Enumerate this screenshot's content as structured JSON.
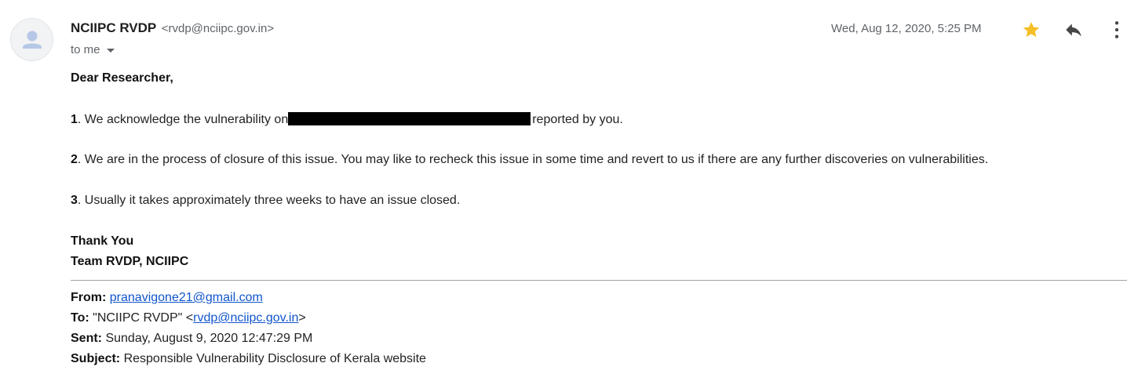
{
  "header": {
    "sender_name": "NCIIPC RVDP",
    "sender_email": "<rvdp@nciipc.gov.in>",
    "recipient_label": "to me",
    "date": "Wed, Aug 12, 2020, 5:25 PM",
    "starred": true,
    "icons": {
      "avatar": "default-person-icon",
      "star": "star-icon",
      "reply": "reply-icon",
      "more": "more-vert-icon",
      "caret": "caret-down-icon"
    },
    "colors": {
      "star": "#f6bf26",
      "link": "#1155cc"
    }
  },
  "body": {
    "greeting": "Dear Researcher,",
    "items": [
      {
        "num": "1",
        "text_before": ". We acknowledge the vulnerability on",
        "text_after": "reported by you."
      },
      {
        "num": "2",
        "text": ". We are in the process of closure of this issue. You may like to recheck this issue in some time and revert to us if there are any further discoveries on vulnerabilities."
      },
      {
        "num": "3",
        "text": ". Usually it takes approximately three weeks to have an issue closed."
      }
    ],
    "sign_line1": "Thank You",
    "sign_line2": "Team RVDP, NCIIPC"
  },
  "quoted": {
    "from_label": "From:",
    "from_value": "pranavigone21@gmail.com",
    "to_label": "To:",
    "to_prefix": "\"NCIIPC RVDP\" <",
    "to_email": "rvdp@nciipc.gov.in",
    "to_suffix": ">",
    "sent_label": "Sent:",
    "sent_value": "Sunday, August 9, 2020 12:47:29 PM",
    "subject_label": "Subject:",
    "subject_value": "Responsible Vulnerability Disclosure of Kerala website"
  }
}
